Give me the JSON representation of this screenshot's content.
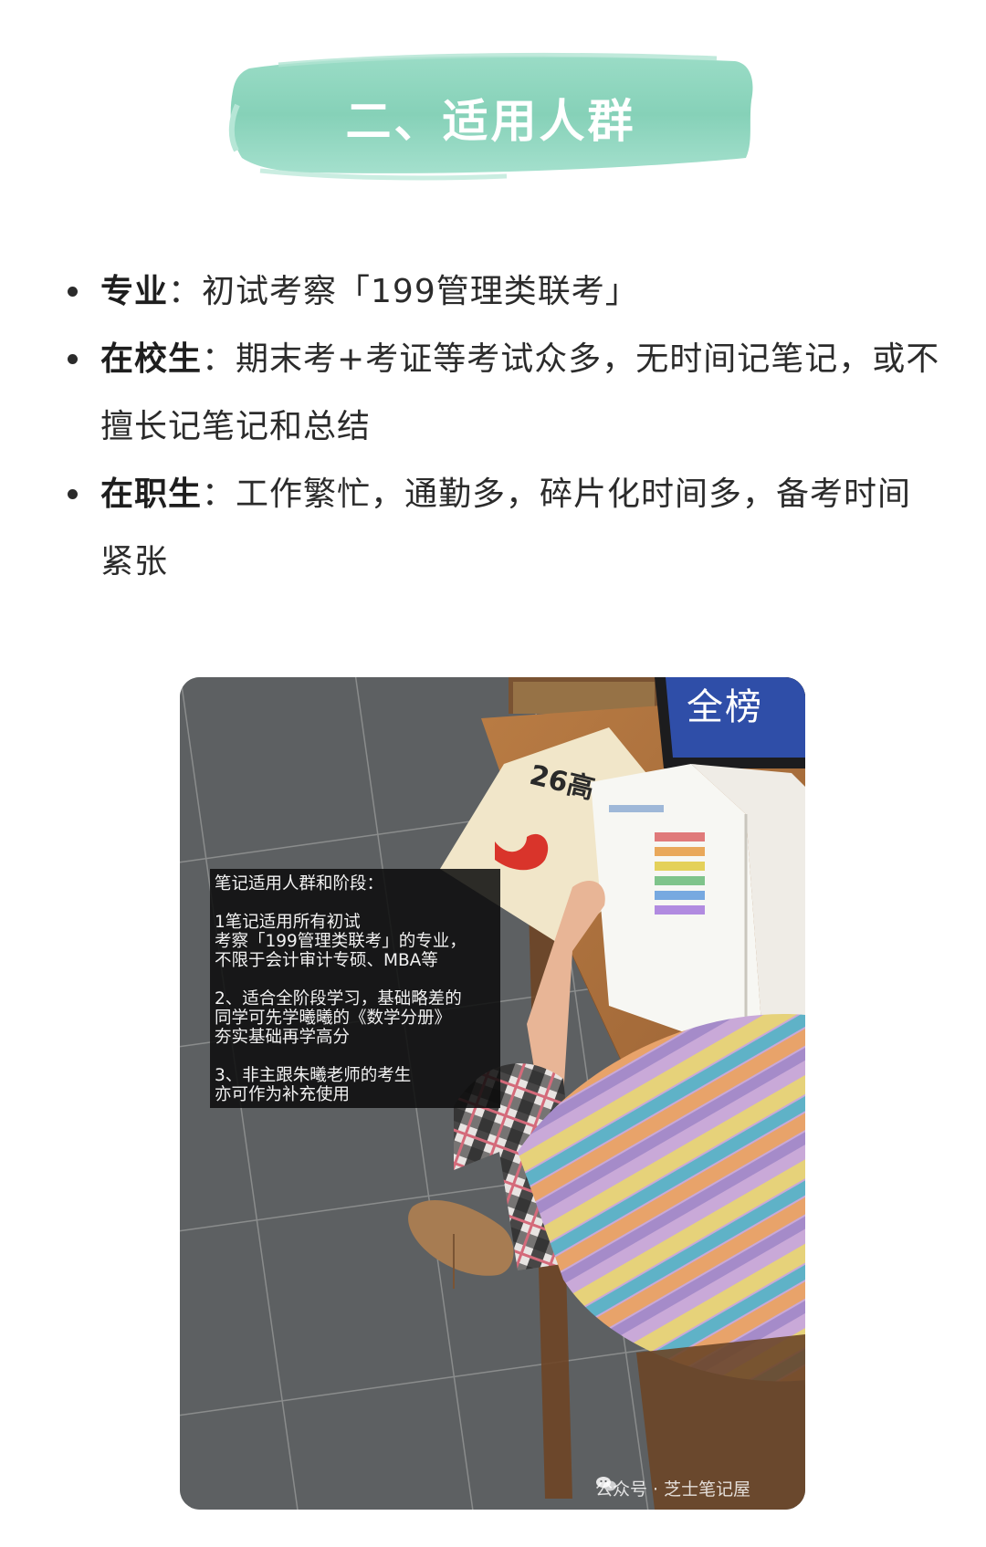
{
  "header": {
    "title": "二、适用人群",
    "banner_color": "#8fd6bf"
  },
  "audience": [
    {
      "term": "专业",
      "separator": "：",
      "description": "初试考察「199管理类联考」"
    },
    {
      "term": "在校生",
      "separator": "：",
      "description": "期末考+考证等考试众多，无时间记笔记，或不擅长记笔记和总结"
    },
    {
      "term": "在职生",
      "separator": "：",
      "description": "工作繁忙，通勤多，碎片化时间多，备考时间紧张"
    }
  ],
  "photo": {
    "overlay_lines": [
      "笔记适用人群和阶段：",
      "",
      "1笔记适用所有初试",
      "考察「199管理类联考」的专业，",
      "不限于会计审计专硕、MBA等",
      "",
      "2、适合全阶段学习，基础略差的",
      "同学可先学曦曦的《数学分册》",
      "夯实基础再学高分",
      "",
      "3、非主跟朱曦老师的考生",
      "亦可作为补充使用"
    ],
    "book_cover_text": "26高",
    "tablet_text": "全榜",
    "watermark": "公众号 · 芝士笔记屋",
    "watermark_icon": "wechat-icon"
  }
}
